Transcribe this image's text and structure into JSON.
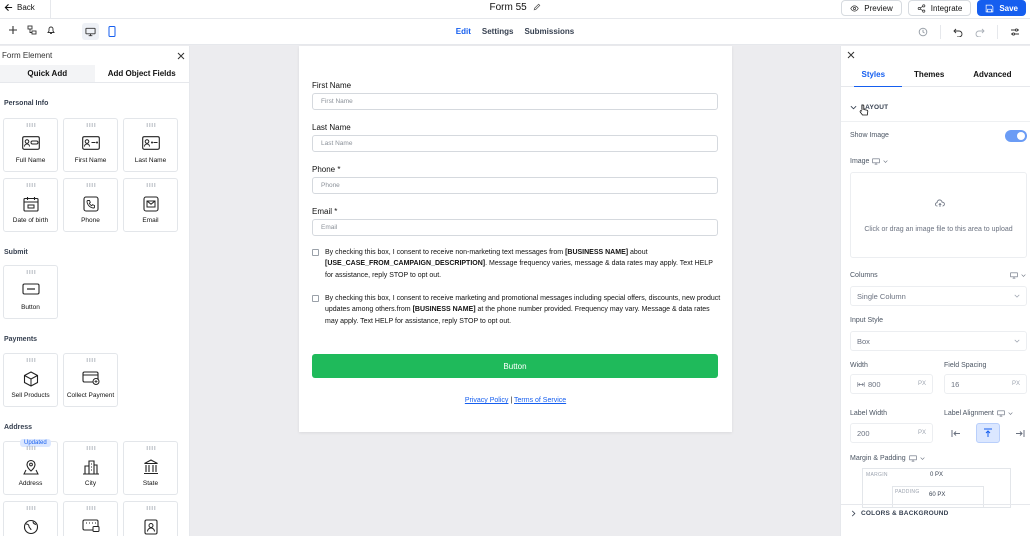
{
  "topbar": {
    "back_label": "Back",
    "form_title": "Form 55",
    "preview_label": "Preview",
    "integrate_label": "Integrate",
    "save_label": "Save"
  },
  "toolbar": {
    "tabs": [
      "Edit",
      "Settings",
      "Submissions"
    ],
    "active_tab": "Edit"
  },
  "left_panel": {
    "title": "Form Element",
    "tabs": [
      "Quick Add",
      "Add Object Fields"
    ],
    "active_tab": "Add Object Fields",
    "sections": {
      "personal_info": {
        "title": "Personal Info",
        "items": [
          "Full Name",
          "First Name",
          "Last Name",
          "Date of birth",
          "Phone",
          "Email"
        ]
      },
      "submit": {
        "title": "Submit",
        "items": [
          "Button"
        ]
      },
      "payments": {
        "title": "Payments",
        "items": [
          "Sell Products",
          "Collect Payment"
        ]
      },
      "address": {
        "title": "Address",
        "items": [
          "Address",
          "City",
          "State"
        ],
        "badge": "Updated"
      }
    }
  },
  "form": {
    "fields": [
      {
        "label": "First Name",
        "placeholder": "First Name"
      },
      {
        "label": "Last Name",
        "placeholder": "Last Name"
      },
      {
        "label": "Phone *",
        "placeholder": "Phone"
      },
      {
        "label": "Email *",
        "placeholder": "Email"
      }
    ],
    "consent_1": {
      "pre": "By checking this box, I consent to receive non-marketing text messages from ",
      "bold1": "[BUSINESS NAME]",
      "mid": " about ",
      "bold2": "[USE_CASE_FROM_CAMPAIGN_DESCRIPTION]",
      "post": ". Message frequency varies, message & data rates may apply. Text HELP for assistance, reply STOP to opt out."
    },
    "consent_2": {
      "pre": "By checking this box, I consent to receive marketing and promotional messages including special offers, discounts, new product updates among others.from ",
      "bold1": "[BUSINESS NAME]",
      "post": " at the phone number provided. Frequency may vary. Message & data rates may apply. Text HELP for assistance, reply STOP to opt out."
    },
    "button_label": "Button",
    "privacy_label": "Privacy Policy",
    "link_sep": " | ",
    "terms_label": "Terms of Service"
  },
  "right_panel": {
    "tabs": [
      "Styles",
      "Themes",
      "Advanced"
    ],
    "active_tab": "Styles",
    "layout_title": "LAYOUT",
    "show_image_label": "Show Image",
    "show_image_on": true,
    "image_label": "Image",
    "upload_text": "Click or drag an image file to this area to upload",
    "columns_label": "Columns",
    "columns_value": "Single Column",
    "input_style_label": "Input Style",
    "input_style_value": "Box",
    "width_label": "Width",
    "width_value": "800",
    "width_unit": "PX",
    "field_spacing_label": "Field Spacing",
    "field_spacing_value": "16",
    "field_spacing_unit": "PX",
    "label_width_label": "Label Width",
    "label_width_value": "200",
    "label_width_unit": "PX",
    "label_alignment_label": "Label Alignment",
    "margin_padding_label": "Margin & Padding",
    "margin_title": "MARGIN",
    "margin_value": "0 PX",
    "padding_title": "PADDING",
    "padding_value": "60 PX",
    "colors_title": "COLORS & BACKGROUND"
  }
}
